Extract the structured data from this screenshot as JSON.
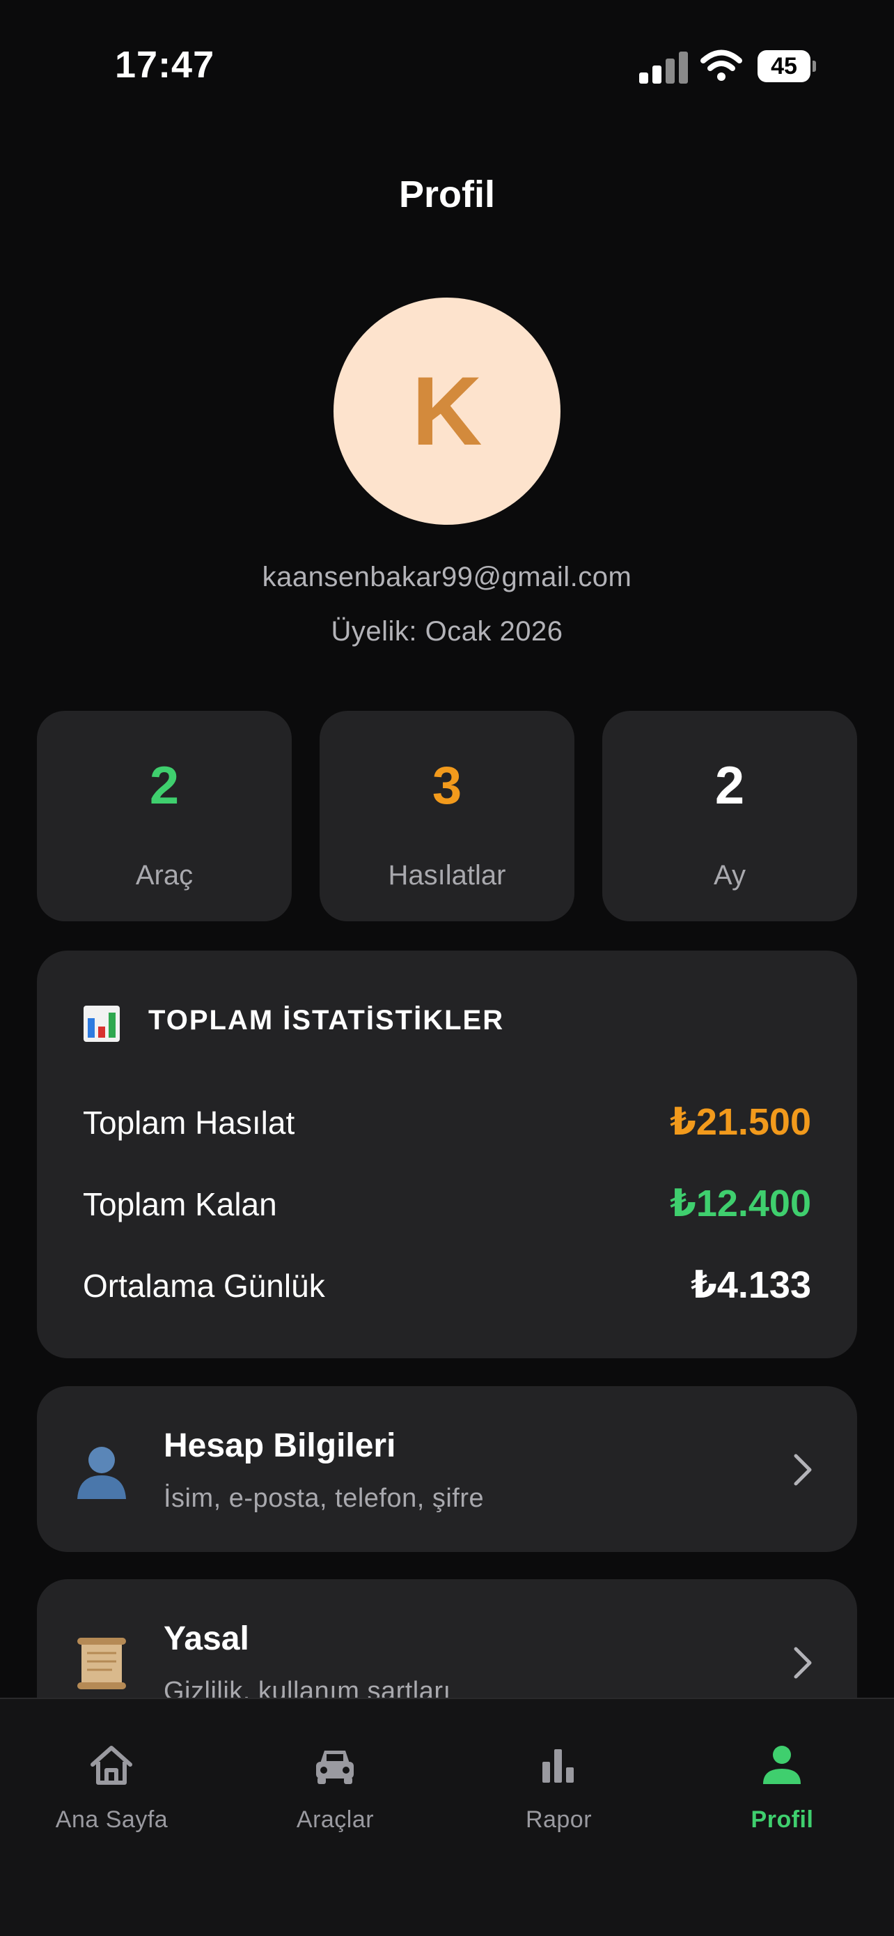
{
  "status_bar": {
    "time": "17:47",
    "battery": "45"
  },
  "header": {
    "title": "Profil"
  },
  "profile": {
    "avatar_letter": "K",
    "email": "kaansenbakar99@gmail.com",
    "membership": "Üyelik: Ocak 2026"
  },
  "stats": [
    {
      "value": "2",
      "label": "Araç",
      "color": "#3fcf6e"
    },
    {
      "value": "3",
      "label": "Hasılatlar",
      "color": "#f29a1c"
    },
    {
      "value": "2",
      "label": "Ay",
      "color": "#ffffff"
    }
  ],
  "totals": {
    "icon": "bar-chart-icon",
    "title": "TOPLAM İSTATİSTİKLER",
    "rows": [
      {
        "label": "Toplam Hasılat",
        "value": "₺21.500",
        "color": "#f29a1c"
      },
      {
        "label": "Toplam Kalan",
        "value": "₺12.400",
        "color": "#3fcf6e"
      },
      {
        "label": "Ortalama Günlük",
        "value": "₺4.133",
        "color": "#ffffff"
      }
    ]
  },
  "menu": [
    {
      "icon": "user-silhouette-icon",
      "title": "Hesap Bilgileri",
      "subtitle": "İsim, e-posta, telefon, şifre"
    },
    {
      "icon": "scroll-icon",
      "title": "Yasal",
      "subtitle": "Gizlilik, kullanım şartları"
    }
  ],
  "tab_bar": {
    "active_color": "#3fcf6e",
    "items": [
      {
        "icon": "home-icon",
        "label": "Ana Sayfa",
        "active": false
      },
      {
        "icon": "car-icon",
        "label": "Araçlar",
        "active": false
      },
      {
        "icon": "chart-icon",
        "label": "Rapor",
        "active": false
      },
      {
        "icon": "person-icon",
        "label": "Profil",
        "active": true
      }
    ]
  }
}
